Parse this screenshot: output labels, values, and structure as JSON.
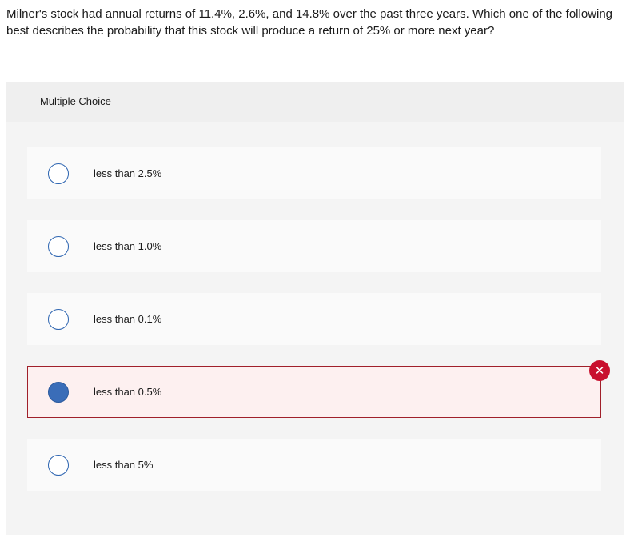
{
  "question": {
    "text": "Milner's stock had annual returns of 11.4%, 2.6%, and 14.8% over the past three years. Which one of the following best describes the probability that this stock will produce a return of 25% or more next year?"
  },
  "multiple_choice": {
    "header": "Multiple Choice",
    "options": [
      {
        "label": "less than 2.5%",
        "selected": false
      },
      {
        "label": "less than 1.0%",
        "selected": false
      },
      {
        "label": "less than 0.1%",
        "selected": false
      },
      {
        "label": "less than 0.5%",
        "selected": true,
        "status": "incorrect"
      },
      {
        "label": "less than 5%",
        "selected": false
      }
    ]
  },
  "feedback": {
    "incorrect_icon": "close-icon",
    "incorrect_color": "#c8102e",
    "selected_radio_color": "#3a6db8"
  }
}
